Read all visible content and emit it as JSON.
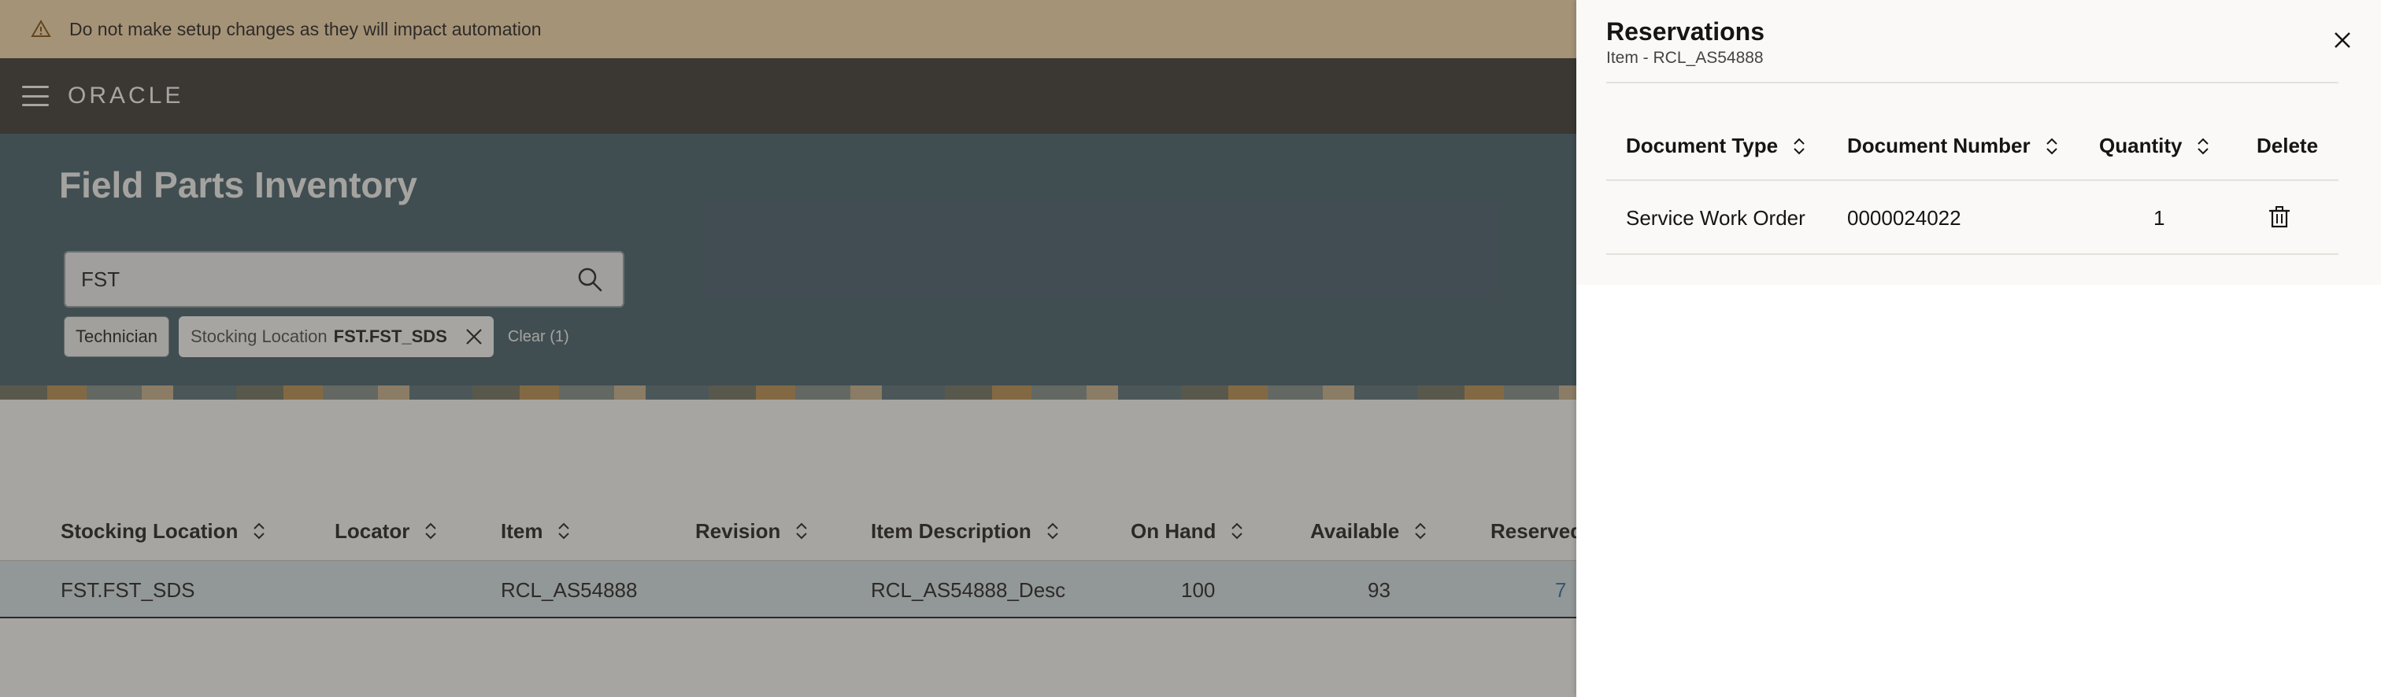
{
  "banner": {
    "message": "Do not make setup changes as they will impact automation",
    "icon": "warning-icon"
  },
  "header": {
    "logo": "ORACLE",
    "menu_icon": "hamburger-icon"
  },
  "page": {
    "title": "Field Parts Inventory",
    "search": {
      "value": "FST",
      "icon": "search-icon"
    },
    "filters": {
      "chips": [
        {
          "label": "Technician"
        },
        {
          "key": "Stocking Location",
          "value": "FST.FST_SDS"
        }
      ],
      "clear_label": "Clear (1)"
    }
  },
  "table": {
    "columns": [
      "Stocking Location",
      "Locator",
      "Item",
      "Revision",
      "Item Description",
      "On Hand",
      "Available",
      "Reserved"
    ],
    "rows": [
      {
        "stocking_location": "FST.FST_SDS",
        "locator": "",
        "item": "RCL_AS54888",
        "revision": "",
        "item_description": "RCL_AS54888_Desc",
        "on_hand": "100",
        "available": "93",
        "reserved": "7"
      }
    ]
  },
  "drawer": {
    "title": "Reservations",
    "subtitle": "Item - RCL_AS54888",
    "columns": [
      "Document Type",
      "Document Number",
      "Quantity",
      "Delete"
    ],
    "rows": [
      {
        "document_type": "Service Work Order",
        "document_number": "0000024022",
        "quantity": "1"
      }
    ]
  },
  "colors": {
    "banner_bg": "#fcdcae",
    "header_bg": "#312d2a",
    "band_bg": "#3a5866",
    "selected_row_bg": "#d6e4ec",
    "link": "#2b6aa0"
  }
}
